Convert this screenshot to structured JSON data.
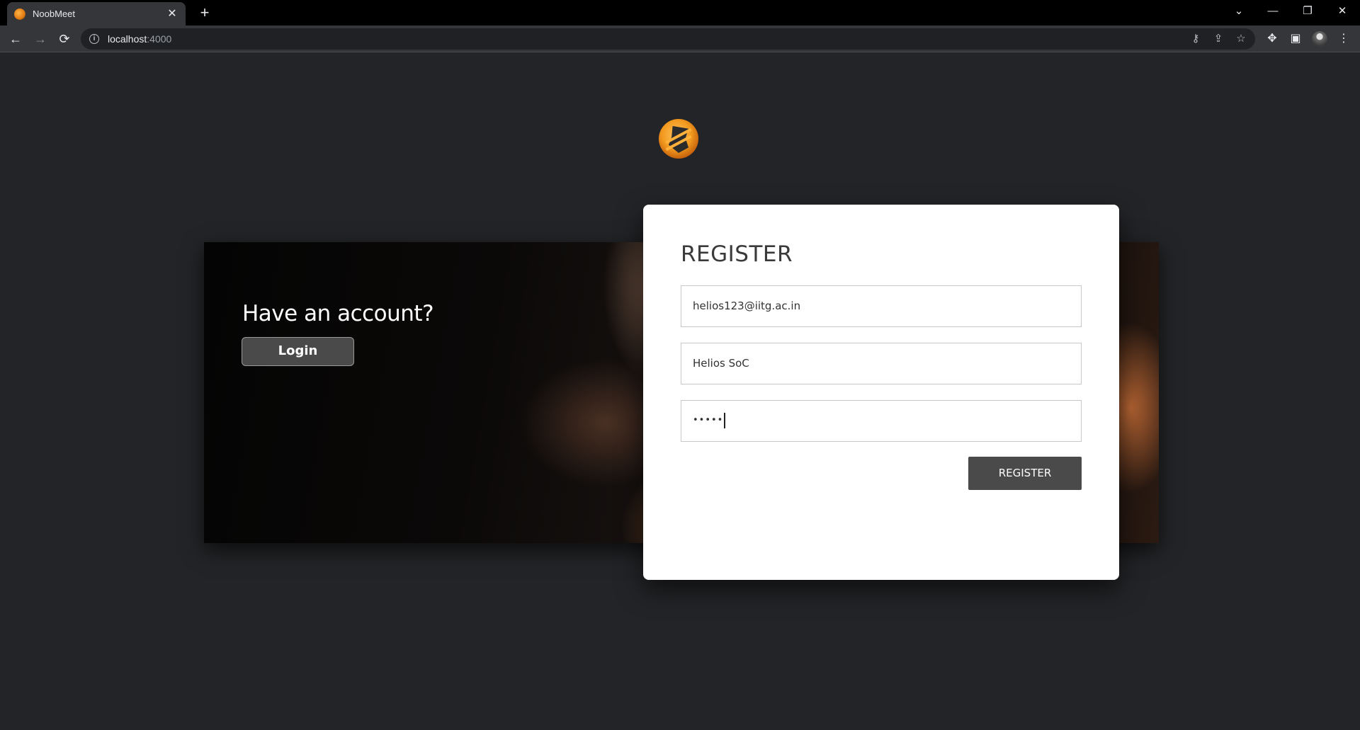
{
  "browser": {
    "tab_title": "NoobMeet",
    "tab_close": "✕",
    "new_tab": "+",
    "url_host": "localhost",
    "url_port": ":4000",
    "icons": {
      "back": "arrow-left-icon",
      "forward": "arrow-right-icon",
      "reload": "reload-icon",
      "info": "info-icon",
      "key": "key-icon",
      "share": "share-icon",
      "bookmark": "star-icon",
      "extensions": "puzzle-icon",
      "side_panel": "side-panel-icon",
      "menu": "kebab-menu-icon"
    }
  },
  "left_panel": {
    "heading": "Have an account?",
    "login_label": "Login"
  },
  "register_card": {
    "title": "REGISTER",
    "email_value": "helios123@iitg.ac.in",
    "name_value": "Helios SoC",
    "password_masked": "•••••",
    "submit_label": "REGISTER"
  },
  "colors": {
    "page_bg": "#232427",
    "card_bg": "#ffffff",
    "button_bg": "#4a4a4a",
    "accent_orange": "#f29a1f"
  }
}
